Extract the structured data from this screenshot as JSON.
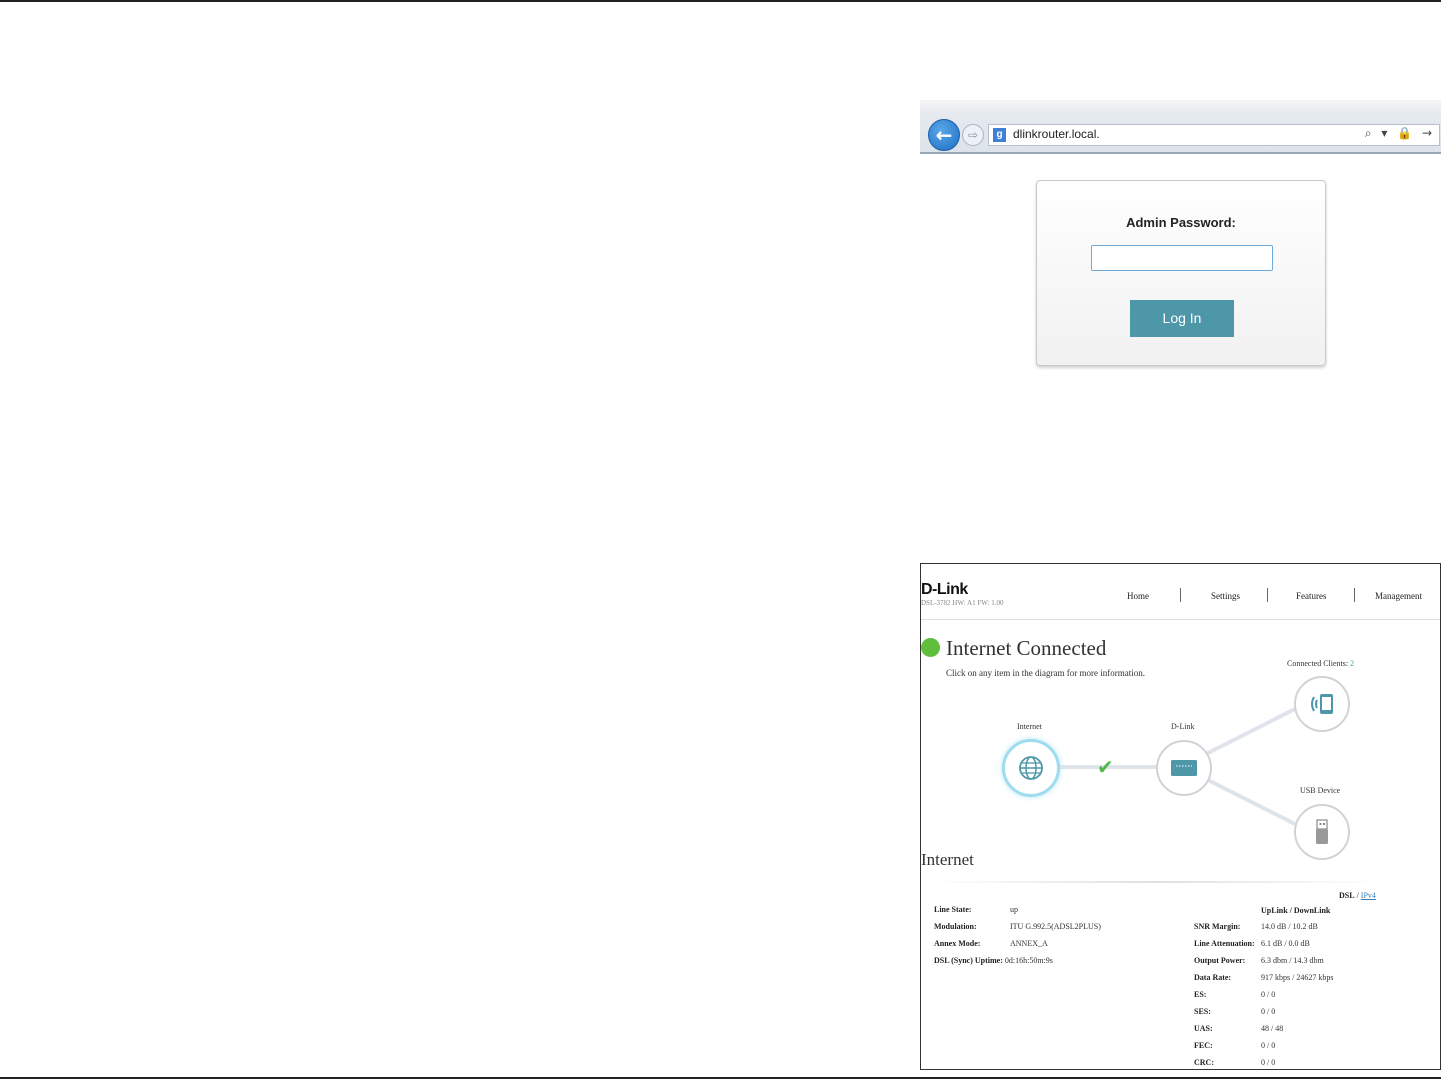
{
  "browser": {
    "url": "dlinkrouter.local.",
    "favicon": "g",
    "back_icon": "←",
    "forward_icon": "⇨",
    "tools": "⌕ ▾ 🔒 →"
  },
  "login": {
    "label": "Admin Password:",
    "password_value": "",
    "button": "Log In"
  },
  "router": {
    "brand": "D-Link",
    "model_info": "DSL-3782  HW: A1  FW: 1.00",
    "nav": [
      "Home",
      "Settings",
      "Features",
      "Management"
    ],
    "status": "Internet Connected",
    "status_color": "#5fbe3c",
    "hint": "Click on any item in the diagram for more information.",
    "diagram": {
      "internet_label": "Internet",
      "router_label": "D-Link",
      "clients_label": "Connected Clients:",
      "clients_count": "2",
      "usb_label": "USB Device",
      "link_status_icon": "checkmark-icon"
    },
    "section_title": "Internet",
    "tabs": {
      "dsl": "DSL",
      "sep": "/",
      "ipv4": "IPv4"
    },
    "left": {
      "line_state_label": "Line State:",
      "line_state": "up",
      "modulation_label": "Modulation:",
      "modulation": "ITU G.992.5(ADSL2PLUS)",
      "annex_label": "Annex Mode:",
      "annex": "ANNEX_A",
      "uptime_label": "DSL (Sync) Uptime:",
      "uptime": "0d:16h:50m:9s"
    },
    "right": {
      "header": "UpLink / DownLink",
      "rows": [
        {
          "label": "SNR Margin:",
          "value": "14.0 dB / 10.2 dB"
        },
        {
          "label": "Line Attenuation:",
          "value": "6.1 dB / 0.0 dB"
        },
        {
          "label": "Output Power:",
          "value": "6.3 dbm / 14.3 dbm"
        },
        {
          "label": "Data Rate:",
          "value": "917 kbps / 24627 kbps"
        },
        {
          "label": "ES:",
          "value": "0 / 0"
        },
        {
          "label": "SES:",
          "value": "0 / 0"
        },
        {
          "label": "UAS:",
          "value": "48 / 48"
        },
        {
          "label": "FEC:",
          "value": "0 / 0"
        },
        {
          "label": "CRC:",
          "value": "0 / 0"
        }
      ]
    },
    "accent_color": "#4e97a8"
  }
}
